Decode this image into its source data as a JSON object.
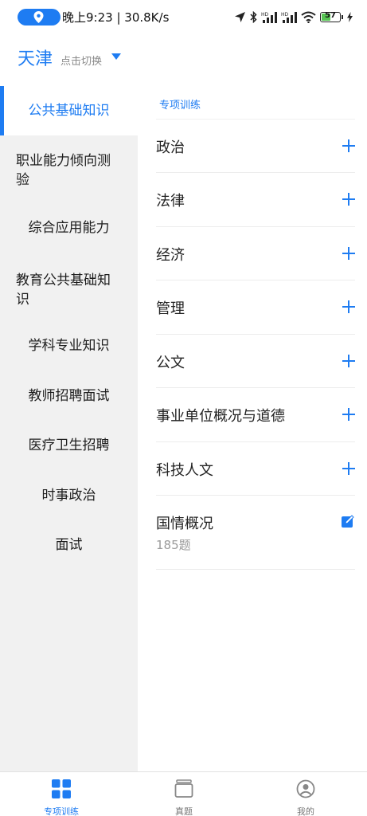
{
  "status_bar": {
    "time_speed": "晚上9:23 | 30.8K/s",
    "battery_level": "57",
    "accent_color": "#1e7cf2"
  },
  "city": {
    "name": "天津",
    "hint": "点击切换"
  },
  "sidebar": {
    "items": [
      {
        "label": "公共基础知识",
        "active": true
      },
      {
        "label": "职业能力倾向测验"
      },
      {
        "label": "综合应用能力"
      },
      {
        "label": "教育公共基础知识"
      },
      {
        "label": "学科专业知识"
      },
      {
        "label": "教师招聘面试"
      },
      {
        "label": "医疗卫生招聘"
      },
      {
        "label": "时事政治"
      },
      {
        "label": "面试"
      }
    ]
  },
  "main": {
    "section_label": "专项训练",
    "rows": [
      {
        "label": "政治",
        "action_icon": "plus-icon"
      },
      {
        "label": "法律",
        "action_icon": "plus-icon"
      },
      {
        "label": "经济",
        "action_icon": "plus-icon"
      },
      {
        "label": "管理",
        "action_icon": "plus-icon"
      },
      {
        "label": "公文",
        "action_icon": "plus-icon"
      },
      {
        "label": "事业单位概况与道德",
        "action_icon": "plus-icon"
      },
      {
        "label": "科技人文",
        "action_icon": "plus-icon"
      },
      {
        "label": "国情概况",
        "sub": "185题",
        "action_icon": "edit-icon"
      }
    ]
  },
  "bottom_nav": {
    "items": [
      {
        "label": "专项训练",
        "icon": "grid-icon",
        "active": true
      },
      {
        "label": "真题",
        "icon": "stack-icon"
      },
      {
        "label": "我的",
        "icon": "profile-icon"
      }
    ]
  }
}
